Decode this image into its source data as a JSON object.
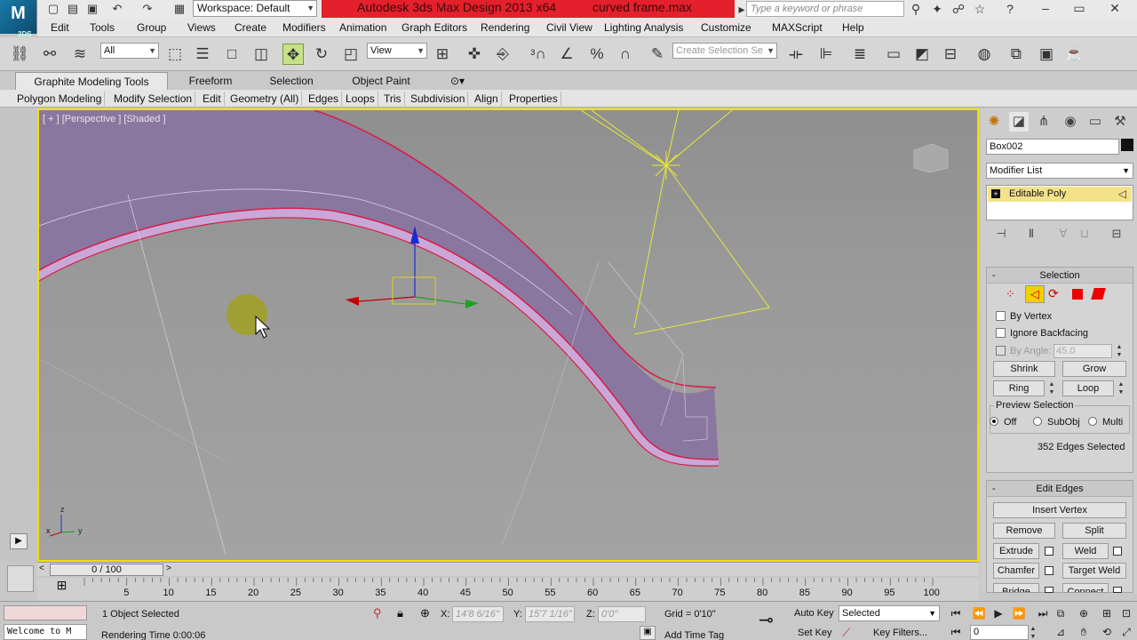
{
  "titlebar": {
    "logo": "M",
    "logo_sub": "3DS",
    "workspace": "Workspace: Default",
    "app_title": "Autodesk 3ds Max Design 2013 x64",
    "file_name": "curved frame.max",
    "search_placeholder": "Type a keyword or phrase"
  },
  "menu": [
    "Edit",
    "Tools",
    "Group",
    "Views",
    "Create",
    "Modifiers",
    "Animation",
    "Graph Editors",
    "Rendering",
    "Civil View",
    "Lighting Analysis",
    "Customize",
    "MAXScript",
    "Help"
  ],
  "toolbar": {
    "selection_filter": "All",
    "ref_coord": "View",
    "named_selection_placeholder": "Create Selection Se"
  },
  "ribbon": {
    "tabs": [
      "Graphite Modeling Tools",
      "Freeform",
      "Selection",
      "Object Paint"
    ],
    "active_tab": "Graphite Modeling Tools",
    "panels": [
      "Polygon Modeling",
      "Modify Selection",
      "Edit",
      "Geometry (All)",
      "Edges",
      "Loops",
      "Tris",
      "Subdivision",
      "Align",
      "Properties"
    ]
  },
  "viewport": {
    "label": "[ + ] [Perspective ] [Shaded ]",
    "axis_x": "x",
    "axis_y": "y",
    "axis_z": "z"
  },
  "command_panel": {
    "object_name": "Box002",
    "object_color": "#111111",
    "modifier_list": "Modifier List",
    "stack_item": "Editable Poly",
    "selection": {
      "title": "Selection",
      "by_vertex": "By Vertex",
      "ignore_backfacing": "Ignore Backfacing",
      "by_angle": "By Angle:",
      "angle_value": "45.0",
      "shrink": "Shrink",
      "grow": "Grow",
      "ring": "Ring",
      "loop": "Loop",
      "preview_title": "Preview Selection",
      "preview_off": "Off",
      "preview_subobj": "SubObj",
      "preview_multi": "Multi",
      "status": "352 Edges Selected"
    },
    "edit_edges": {
      "title": "Edit Edges",
      "insert_vertex": "Insert Vertex",
      "remove": "Remove",
      "split": "Split",
      "extrude": "Extrude",
      "weld": "Weld",
      "chamfer": "Chamfer",
      "target_weld": "Target Weld",
      "bridge": "Bridge",
      "connect": "Connect"
    }
  },
  "timeline": {
    "frame_display": "0 / 100",
    "ticks": [
      "5",
      "10",
      "15",
      "20",
      "25",
      "30",
      "35",
      "40",
      "45",
      "50",
      "55",
      "60",
      "65",
      "70",
      "75",
      "80",
      "85",
      "90",
      "95",
      "100"
    ]
  },
  "status": {
    "maxscript": "Welcome to M",
    "selection_info": "1 Object Selected",
    "prompt": "Rendering Time  0:00:06",
    "x_label": "X:",
    "x_value": "14'8 6/16\"",
    "y_label": "Y:",
    "y_value": "15'7 1/16\"",
    "z_label": "Z:",
    "z_value": "0'0\"",
    "grid": "Grid = 0'10\"",
    "add_time_tag": "Add Time Tag",
    "auto_key": "Auto Key",
    "set_key": "Set Key",
    "key_mode": "Selected",
    "key_filters": "Key Filters...",
    "frame": "0"
  },
  "colors": {
    "title_accent": "#e3202b",
    "viewport_border": "#f0e000",
    "object_fill": "#8a77a0",
    "selected_edges": "#d6204a"
  }
}
